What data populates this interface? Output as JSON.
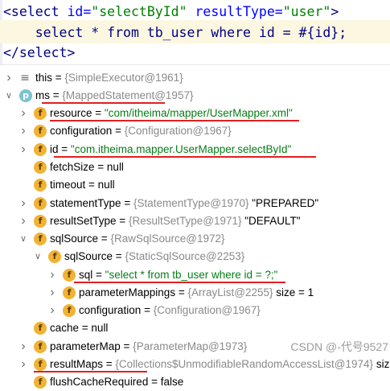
{
  "code": {
    "line1": {
      "open": "<select",
      "attr1": " id=",
      "val1": "\"selectById\"",
      "attr2": " resultType=",
      "val2": "\"user\"",
      "close": ">"
    },
    "line2": {
      "text": "    select * from tb_user where id = #{id};"
    },
    "line3": {
      "text": "</select>"
    }
  },
  "tree": [
    {
      "name": "this",
      "eq": " = ",
      "type": "{SimpleExecutor@1961}",
      "value": "",
      "extra": "",
      "badge": "eq"
    },
    {
      "name": "ms",
      "eq": " = ",
      "type": "{MappedStatement@1957}",
      "value": "",
      "extra": "",
      "badge": "p"
    },
    {
      "name": "resource",
      "eq": " = ",
      "type": "",
      "value": "\"com/itheima/mapper/UserMapper.xml\"",
      "extra": "",
      "badge": "f"
    },
    {
      "name": "configuration",
      "eq": " = ",
      "type": "{Configuration@1967}",
      "value": "",
      "extra": "",
      "badge": "f"
    },
    {
      "name": "id",
      "eq": " = ",
      "type": "",
      "value": "\"com.itheima.mapper.UserMapper.selectById\"",
      "extra": "",
      "badge": "f"
    },
    {
      "name": "fetchSize",
      "eq": " = ",
      "type": "",
      "value": "",
      "extra": "null",
      "badge": "f"
    },
    {
      "name": "timeout",
      "eq": " = ",
      "type": "",
      "value": "",
      "extra": "null",
      "badge": "f"
    },
    {
      "name": "statementType",
      "eq": " = ",
      "type": "{StatementType@1970}",
      "value": "",
      "extra": " \"PREPARED\"",
      "badge": "f"
    },
    {
      "name": "resultSetType",
      "eq": " = ",
      "type": "{ResultSetType@1971}",
      "value": "",
      "extra": " \"DEFAULT\"",
      "badge": "f"
    },
    {
      "name": "sqlSource",
      "eq": " = ",
      "type": "{RawSqlSource@1972}",
      "value": "",
      "extra": "",
      "badge": "f"
    },
    {
      "name": "sqlSource",
      "eq": " = ",
      "type": "{StaticSqlSource@2253}",
      "value": "",
      "extra": "",
      "badge": "f"
    },
    {
      "name": "sql",
      "eq": " = ",
      "type": "",
      "value": "\"select * from tb_user where id = ?;\"",
      "extra": "",
      "badge": "f"
    },
    {
      "name": "parameterMappings",
      "eq": " = ",
      "type": "{ArrayList@2255}",
      "value": "",
      "extra": "  size = 1",
      "badge": "f"
    },
    {
      "name": "configuration",
      "eq": " = ",
      "type": "{Configuration@1967}",
      "value": "",
      "extra": "",
      "badge": "f"
    },
    {
      "name": "cache",
      "eq": " = ",
      "type": "",
      "value": "",
      "extra": "null",
      "badge": "f"
    },
    {
      "name": "parameterMap",
      "eq": " = ",
      "type": "{ParameterMap@1973}",
      "value": "",
      "extra": "",
      "badge": "f"
    },
    {
      "name": "resultMaps",
      "eq": " = ",
      "type": "{Collections$UnmodifiableRandomAccessList@1974}",
      "value": "",
      "extra": "  size",
      "badge": "f"
    },
    {
      "name": "flushCacheRequired",
      "eq": " = ",
      "type": "",
      "value": "",
      "extra": "false",
      "badge": "f"
    }
  ],
  "watermark": "CSDN @-代号9527",
  "colors": {
    "string_value": "#067d17",
    "type_ref": "#8a8a8a",
    "field_badge": "#f2b233",
    "underline": "#e02020"
  }
}
